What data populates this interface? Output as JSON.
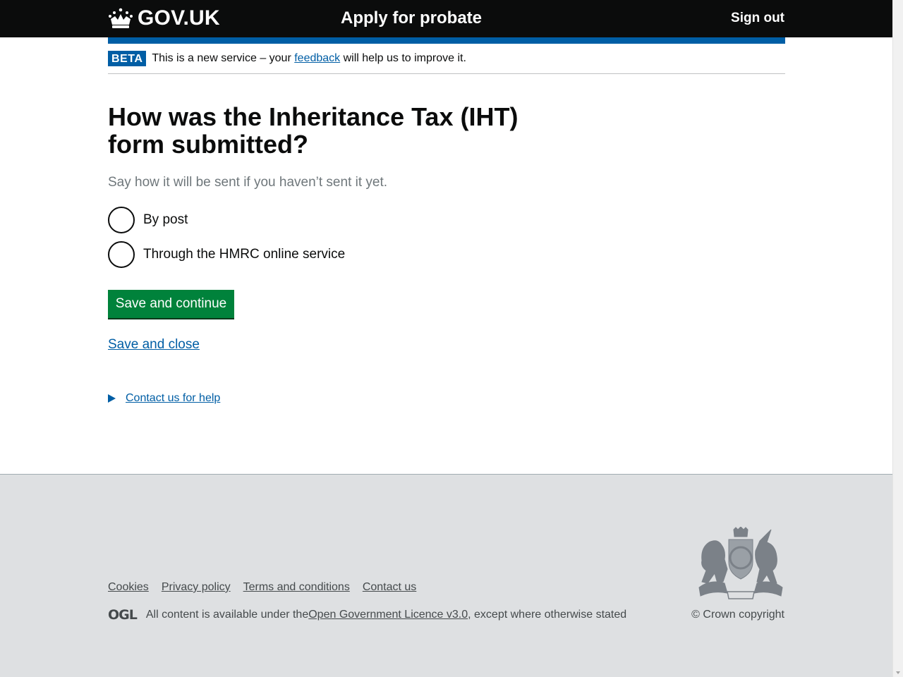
{
  "header": {
    "logo_text": "GOV.UK",
    "logo_icon": "crown-icon",
    "service_name": "Apply for probate",
    "sign_out": "Sign out"
  },
  "phase_banner": {
    "tag": "BETA",
    "text_before": "This is a new service – your ",
    "feedback_link": "feedback",
    "text_after": " will help us to improve it."
  },
  "main": {
    "heading": "How was the Inheritance Tax (IHT) form submitted?",
    "hint": "Say how it will be sent if you haven’t sent it yet.",
    "options": [
      {
        "label": "By post",
        "selected": false
      },
      {
        "label": "Through the HMRC online service",
        "selected": false
      }
    ],
    "save_continue": "Save and continue",
    "save_close": "Save and close",
    "contact_help": "Contact us for help"
  },
  "footer": {
    "links": [
      "Cookies",
      "Privacy policy",
      "Terms and conditions",
      "Contact us"
    ],
    "ogl_logo": "OGL",
    "licence_before": "All content is available under the ",
    "licence_link": "Open Government Licence v3.0",
    "licence_after": ", except where otherwise stated",
    "copyright": "© Crown copyright",
    "crest_icon": "royal-coat-of-arms-icon"
  },
  "colors": {
    "header_bg": "#0b0c0c",
    "brand_blue": "#005ea5",
    "button_green": "#00823b",
    "footer_bg": "#dee0e2",
    "hint_grey": "#6f777b"
  }
}
